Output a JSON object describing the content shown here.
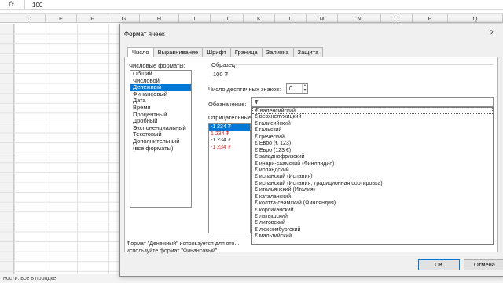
{
  "formula_bar": {
    "fx_symbol": "fx",
    "value": "100"
  },
  "columns": [
    "D",
    "E",
    "F",
    "G",
    "H",
    "I",
    "J",
    "K",
    "L",
    "M",
    "N",
    "O",
    "P",
    "Q"
  ],
  "status_bar": {
    "text": "ности: все в порядке"
  },
  "dialog": {
    "title": "Формат ячеек",
    "help": "?",
    "tabs": [
      {
        "label": "Число",
        "active": true
      },
      {
        "label": "Выравнивание"
      },
      {
        "label": "Шрифт"
      },
      {
        "label": "Граница"
      },
      {
        "label": "Заливка"
      },
      {
        "label": "Защита"
      }
    ],
    "categories_label": "Числовые форматы:",
    "categories": [
      "Общий",
      "Числовой",
      "Денежный",
      "Финансовый",
      "Дата",
      "Время",
      "Процентный",
      "Дробный",
      "Экспоненциальный",
      "Текстовый",
      "Дополнительный",
      "(все форматы)"
    ],
    "selected_category": "Денежный",
    "sample_label": "Образец",
    "sample_value": "100 ₮",
    "decimals_label": "Число десятичных знаков:",
    "decimals_value": "0",
    "symbol_label": "Обозначение:",
    "symbol_value": "₮",
    "negative_label": "Отрицательные",
    "negative_items": [
      {
        "text": "-1 234 ₮",
        "selected": true,
        "red": false
      },
      {
        "text": "1 234 ₮",
        "red": true
      },
      {
        "text": "-1 234 ₮",
        "red": false
      },
      {
        "text": "-1 234 ₮",
        "red": true
      }
    ],
    "symbol_options": [
      "€ валенсийский",
      "€ верхнелужицкий",
      "€ галисийский",
      "€ гальский",
      "€ греческий",
      "€ Евро (€ 123)",
      "€ Евро (123 €)",
      "€ западнофризский",
      "€ инари-саамский (Финляндия)",
      "€ ирландский",
      "€ испанский (Испания)",
      "€ испанский (Испания, традиционная сортировка)",
      "€ итальянский (Италия)",
      "€ каталанский",
      "€ колтта-саамский (Финляндия)",
      "€ корсиканский",
      "€ латышский",
      "€ литовский",
      "€ люксембургский",
      "€ мальтийский"
    ],
    "description": "Формат \"Денежный\" используется для ото... используйте формат \"Финансовый\".",
    "ok_label": "OK",
    "cancel_label": "Отмена"
  },
  "colors": {
    "selection": "#0078d7",
    "negative_red": "#e02020"
  }
}
